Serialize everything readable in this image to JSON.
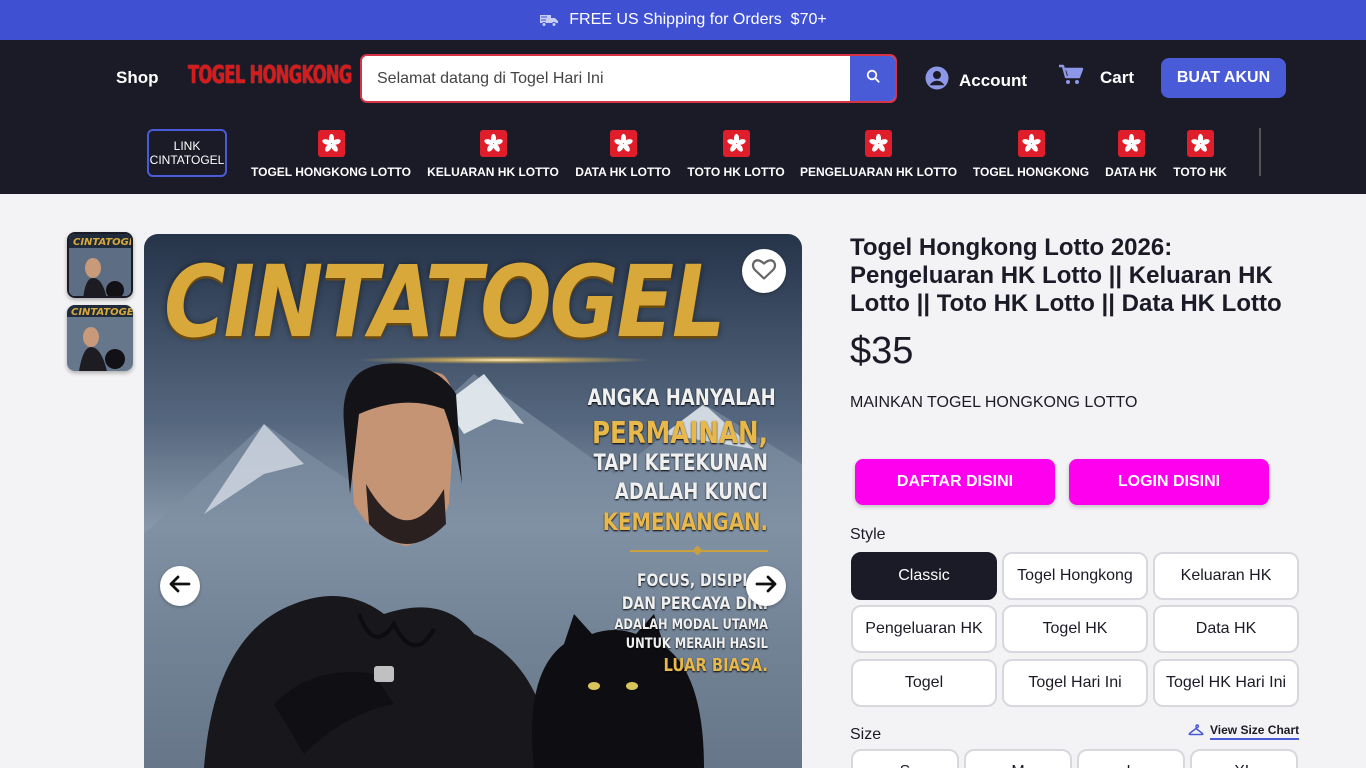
{
  "promo": {
    "text": "FREE US Shipping for Orders  $70+",
    "icon": "truck-icon"
  },
  "header": {
    "shop_label": "Shop",
    "logo_text": "TOGEL HONGKONG",
    "search": {
      "placeholder": "Selamat datang di Togel Hari Ini",
      "icon": "search-icon"
    },
    "account_label": "Account",
    "cart_label": "Cart",
    "signup_label": "BUAT AKUN"
  },
  "nav": {
    "link_box": {
      "line1": "LINK",
      "line2": "CINTATOGEL"
    },
    "categories": [
      {
        "label": "TOGEL HONGKONG LOTTO"
      },
      {
        "label": "KELUARAN HK LOTTO"
      },
      {
        "label": "DATA HK LOTTO"
      },
      {
        "label": "TOTO HK LOTTO"
      },
      {
        "label": "PENGELUARAN HK LOTTO"
      },
      {
        "label": "TOGEL HONGKONG"
      },
      {
        "label": "DATA HK"
      },
      {
        "label": "TOTO HK"
      }
    ]
  },
  "poster": {
    "title": "CINTATOGEL",
    "lines": [
      "ANGKA HANYALAH",
      "PERMAINAN,",
      "TAPI KETEKUNAN",
      "ADALAH KUNCI",
      "KEMENANGAN.",
      "FOCUS, DISIPLIN",
      "DAN PERCAYA DIRI",
      "ADALAH MODAL UTAMA",
      "UNTUK MERAIH HASIL",
      "LUAR BIASA."
    ]
  },
  "product": {
    "title": "Togel Hongkong Lotto 2026: Pengeluaran HK Lotto || Keluaran HK Lotto || Toto HK Lotto || Data HK Lotto",
    "price": "$35",
    "subtitle": "MAINKAN TOGEL HONGKONG LOTTO",
    "buttons": {
      "daftar": "DAFTAR DISINI",
      "login": "LOGIN DISINI"
    },
    "style_label": "Style",
    "styles": [
      "Classic",
      "Togel Hongkong",
      "Keluaran HK",
      "Pengeluaran HK",
      "Togel HK",
      "Data HK",
      "Togel",
      "Togel Hari Ini",
      "Togel HK Hari Ini"
    ],
    "selected_style": "Classic",
    "size_label": "Size",
    "size_chart_label": "View Size Chart",
    "sizes": [
      "S",
      "M",
      "L",
      "XL"
    ]
  },
  "colors": {
    "promo_bar": "#3f50d2",
    "header_bg": "#1b1a27",
    "accent_blue": "#4a5bd8",
    "pink_cta": "#ff00ee",
    "search_border": "#d63344",
    "logo_red": "#d61b1b"
  }
}
